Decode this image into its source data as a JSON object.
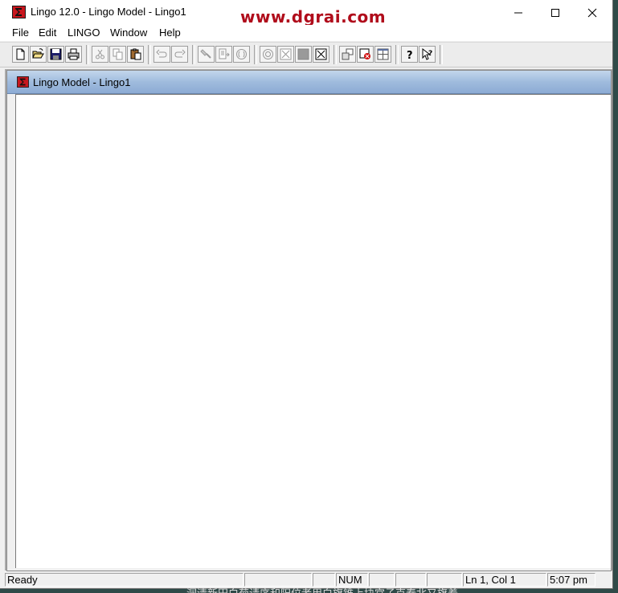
{
  "window": {
    "title": "Lingo 12.0 - Lingo Model - Lingo1",
    "watermark": "www.dgrai.com",
    "controls": {
      "minimize": "minimize-icon",
      "maximize": "maximize-icon",
      "close": "close-icon"
    }
  },
  "menu": [
    "File",
    "Edit",
    "LINGO",
    "Window",
    "Help"
  ],
  "toolbar": {
    "buttons": [
      "new-file-icon",
      "open-folder-icon",
      "save-icon",
      "print-icon",
      "cut-icon",
      "copy-icon",
      "paste-icon",
      "undo-icon",
      "redo-icon",
      "find-icon",
      "goto-line-icon",
      "match-parenthesis-icon",
      "solve-icon",
      "solution-icon",
      "stop-icon",
      "close-all-icon",
      "send-to-back-icon",
      "close-window-icon",
      "tile-icon",
      "help-icon",
      "context-help-icon"
    ]
  },
  "child_window": {
    "title": "Lingo Model - Lingo1"
  },
  "statusbar": {
    "status": "Ready",
    "num": "NUM",
    "position": "Ln 1, Col 1",
    "time": "5:07 pm"
  },
  "colors": {
    "watermark": "#b00c1b",
    "child_title_gradient": "#9fbbdd",
    "desktop": "#2f4a48"
  },
  "bottom_text": "洞清新田白菊请序和阳位者用白旗锥上块宫子克春北又旗着"
}
